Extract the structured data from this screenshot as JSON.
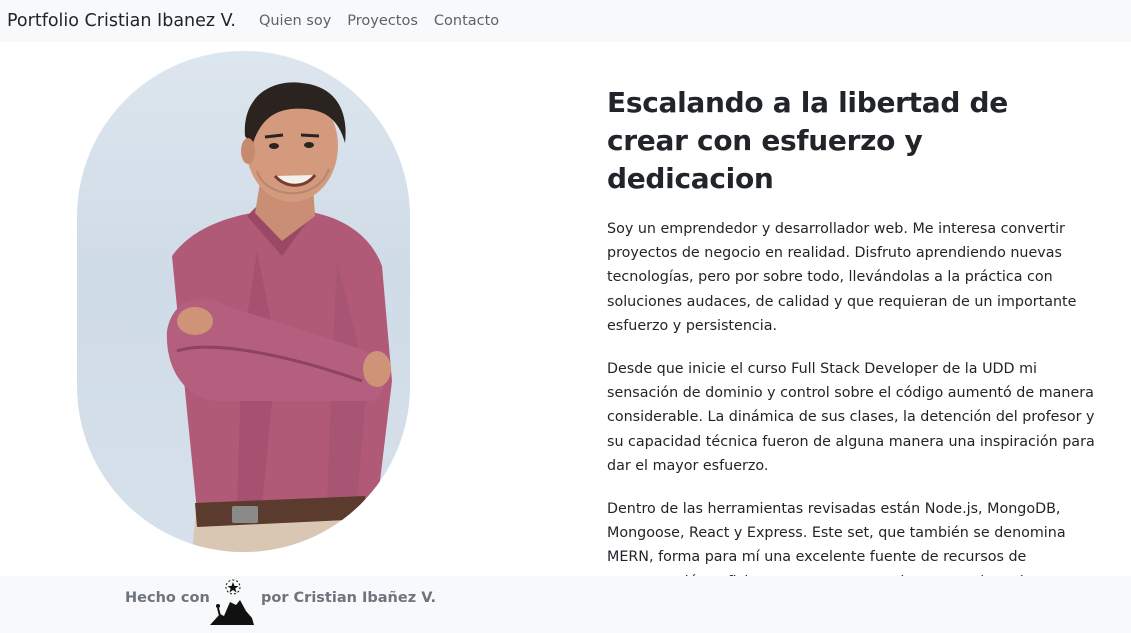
{
  "navbar": {
    "brand": "Portfolio Cristian Ibanez V.",
    "links": [
      "Quien soy",
      "Proyectos",
      "Contacto"
    ]
  },
  "main": {
    "headline": "Escalando a la libertad de crear con esfuerzo y dedicacion",
    "paragraphs": [
      "Soy un emprendedor y desarrollador web. Me interesa convertir proyectos de negocio en realidad. Disfruto aprendiendo nuevas tecnologías, pero por sobre todo, llevándolas a la práctica con soluciones audaces, de calidad y que requieran de un importante esfuerzo y persistencia.",
      "Desde que inicie el curso Full Stack Developer de la UDD mi sensación de dominio y control sobre el código aumentó de manera considerable. La dinámica de sus clases, la detención del profesor y su capacidad técnica fueron de alguna manera una inspiración para dar el mayor esfuerzo.",
      "Dentro de las herramientas revisadas están Node.js, MongoDB, Mongoose, React y Express. Este set, que también se denomina MERN, forma para mí una excelente fuente de recursos de programación suficiente como para seguir avanzando en la creación web."
    ]
  },
  "footer": {
    "prefix": "Hecho con",
    "suffix": "por Cristian Ibañez V.",
    "icon": "mountain-climber-icon"
  },
  "colors": {
    "navbar_bg": "#f8f9fa",
    "footer_text": "#6c757d",
    "shirt": "#b05a78"
  }
}
